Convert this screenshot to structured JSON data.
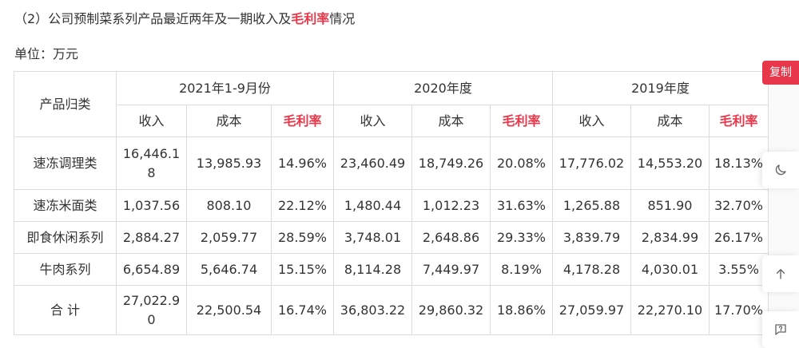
{
  "heading": {
    "prefix": "（2）",
    "text_before": "公司预制菜系列产品最近两年及一期收入及",
    "highlight": "毛利率",
    "text_after": "情况"
  },
  "unit_label": "单位：万元",
  "table": {
    "row_header": "产品归类",
    "periods": [
      "2021年1-9月份",
      "2020年度",
      "2019年度"
    ],
    "sub_headers": [
      "收入",
      "成本",
      "毛利率"
    ],
    "rows": [
      {
        "category": "速冻调理类",
        "cells": [
          "16,446.18",
          "13,985.93",
          "14.96%",
          "23,460.49",
          "18,749.26",
          "20.08%",
          "17,776.02",
          "14,553.20",
          "18.13%"
        ]
      },
      {
        "category": "速冻米面类",
        "cells": [
          "1,037.56",
          "808.10",
          "22.12%",
          "1,480.44",
          "1,012.23",
          "31.63%",
          "1,265.88",
          "851.90",
          "32.70%"
        ]
      },
      {
        "category": "即食休闲系列",
        "cells": [
          "2,884.27",
          "2,059.77",
          "28.59%",
          "3,748.01",
          "2,648.86",
          "29.33%",
          "3,839.79",
          "2,834.99",
          "26.17%"
        ]
      },
      {
        "category": "牛肉系列",
        "cells": [
          "6,654.89",
          "5,646.74",
          "15.15%",
          "8,114.28",
          "7,449.97",
          "8.19%",
          "4,178.28",
          "4,030.01",
          "3.55%"
        ]
      },
      {
        "category": "合 计",
        "cells": [
          "27,022.90",
          "22,500.54",
          "16.74%",
          "36,803.22",
          "29,860.32",
          "18.86%",
          "27,059.97",
          "22,270.10",
          "17.70%"
        ]
      }
    ]
  },
  "sidebar": {
    "copy_label": "复制",
    "icons": [
      "moon-icon",
      "arrow-up-icon",
      "feedback-icon"
    ]
  },
  "colors": {
    "accent": "#e8374a",
    "border": "#dcdcdc",
    "text": "#333333"
  }
}
